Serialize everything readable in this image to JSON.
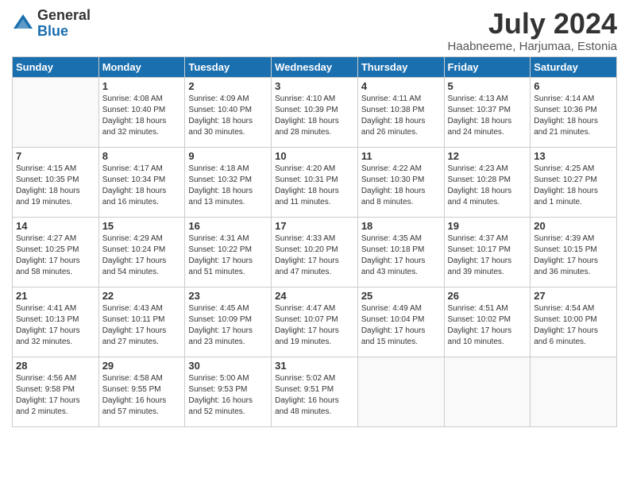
{
  "logo": {
    "general": "General",
    "blue": "Blue"
  },
  "header": {
    "title": "July 2024",
    "subtitle": "Haabneeme, Harjumaa, Estonia"
  },
  "weekdays": [
    "Sunday",
    "Monday",
    "Tuesday",
    "Wednesday",
    "Thursday",
    "Friday",
    "Saturday"
  ],
  "weeks": [
    [
      {
        "day": "",
        "sunrise": "",
        "sunset": "",
        "daylight": ""
      },
      {
        "day": "1",
        "sunrise": "Sunrise: 4:08 AM",
        "sunset": "Sunset: 10:40 PM",
        "daylight": "Daylight: 18 hours and 32 minutes."
      },
      {
        "day": "2",
        "sunrise": "Sunrise: 4:09 AM",
        "sunset": "Sunset: 10:40 PM",
        "daylight": "Daylight: 18 hours and 30 minutes."
      },
      {
        "day": "3",
        "sunrise": "Sunrise: 4:10 AM",
        "sunset": "Sunset: 10:39 PM",
        "daylight": "Daylight: 18 hours and 28 minutes."
      },
      {
        "day": "4",
        "sunrise": "Sunrise: 4:11 AM",
        "sunset": "Sunset: 10:38 PM",
        "daylight": "Daylight: 18 hours and 26 minutes."
      },
      {
        "day": "5",
        "sunrise": "Sunrise: 4:13 AM",
        "sunset": "Sunset: 10:37 PM",
        "daylight": "Daylight: 18 hours and 24 minutes."
      },
      {
        "day": "6",
        "sunrise": "Sunrise: 4:14 AM",
        "sunset": "Sunset: 10:36 PM",
        "daylight": "Daylight: 18 hours and 21 minutes."
      }
    ],
    [
      {
        "day": "7",
        "sunrise": "Sunrise: 4:15 AM",
        "sunset": "Sunset: 10:35 PM",
        "daylight": "Daylight: 18 hours and 19 minutes."
      },
      {
        "day": "8",
        "sunrise": "Sunrise: 4:17 AM",
        "sunset": "Sunset: 10:34 PM",
        "daylight": "Daylight: 18 hours and 16 minutes."
      },
      {
        "day": "9",
        "sunrise": "Sunrise: 4:18 AM",
        "sunset": "Sunset: 10:32 PM",
        "daylight": "Daylight: 18 hours and 13 minutes."
      },
      {
        "day": "10",
        "sunrise": "Sunrise: 4:20 AM",
        "sunset": "Sunset: 10:31 PM",
        "daylight": "Daylight: 18 hours and 11 minutes."
      },
      {
        "day": "11",
        "sunrise": "Sunrise: 4:22 AM",
        "sunset": "Sunset: 10:30 PM",
        "daylight": "Daylight: 18 hours and 8 minutes."
      },
      {
        "day": "12",
        "sunrise": "Sunrise: 4:23 AM",
        "sunset": "Sunset: 10:28 PM",
        "daylight": "Daylight: 18 hours and 4 minutes."
      },
      {
        "day": "13",
        "sunrise": "Sunrise: 4:25 AM",
        "sunset": "Sunset: 10:27 PM",
        "daylight": "Daylight: 18 hours and 1 minute."
      }
    ],
    [
      {
        "day": "14",
        "sunrise": "Sunrise: 4:27 AM",
        "sunset": "Sunset: 10:25 PM",
        "daylight": "Daylight: 17 hours and 58 minutes."
      },
      {
        "day": "15",
        "sunrise": "Sunrise: 4:29 AM",
        "sunset": "Sunset: 10:24 PM",
        "daylight": "Daylight: 17 hours and 54 minutes."
      },
      {
        "day": "16",
        "sunrise": "Sunrise: 4:31 AM",
        "sunset": "Sunset: 10:22 PM",
        "daylight": "Daylight: 17 hours and 51 minutes."
      },
      {
        "day": "17",
        "sunrise": "Sunrise: 4:33 AM",
        "sunset": "Sunset: 10:20 PM",
        "daylight": "Daylight: 17 hours and 47 minutes."
      },
      {
        "day": "18",
        "sunrise": "Sunrise: 4:35 AM",
        "sunset": "Sunset: 10:18 PM",
        "daylight": "Daylight: 17 hours and 43 minutes."
      },
      {
        "day": "19",
        "sunrise": "Sunrise: 4:37 AM",
        "sunset": "Sunset: 10:17 PM",
        "daylight": "Daylight: 17 hours and 39 minutes."
      },
      {
        "day": "20",
        "sunrise": "Sunrise: 4:39 AM",
        "sunset": "Sunset: 10:15 PM",
        "daylight": "Daylight: 17 hours and 36 minutes."
      }
    ],
    [
      {
        "day": "21",
        "sunrise": "Sunrise: 4:41 AM",
        "sunset": "Sunset: 10:13 PM",
        "daylight": "Daylight: 17 hours and 32 minutes."
      },
      {
        "day": "22",
        "sunrise": "Sunrise: 4:43 AM",
        "sunset": "Sunset: 10:11 PM",
        "daylight": "Daylight: 17 hours and 27 minutes."
      },
      {
        "day": "23",
        "sunrise": "Sunrise: 4:45 AM",
        "sunset": "Sunset: 10:09 PM",
        "daylight": "Daylight: 17 hours and 23 minutes."
      },
      {
        "day": "24",
        "sunrise": "Sunrise: 4:47 AM",
        "sunset": "Sunset: 10:07 PM",
        "daylight": "Daylight: 17 hours and 19 minutes."
      },
      {
        "day": "25",
        "sunrise": "Sunrise: 4:49 AM",
        "sunset": "Sunset: 10:04 PM",
        "daylight": "Daylight: 17 hours and 15 minutes."
      },
      {
        "day": "26",
        "sunrise": "Sunrise: 4:51 AM",
        "sunset": "Sunset: 10:02 PM",
        "daylight": "Daylight: 17 hours and 10 minutes."
      },
      {
        "day": "27",
        "sunrise": "Sunrise: 4:54 AM",
        "sunset": "Sunset: 10:00 PM",
        "daylight": "Daylight: 17 hours and 6 minutes."
      }
    ],
    [
      {
        "day": "28",
        "sunrise": "Sunrise: 4:56 AM",
        "sunset": "Sunset: 9:58 PM",
        "daylight": "Daylight: 17 hours and 2 minutes."
      },
      {
        "day": "29",
        "sunrise": "Sunrise: 4:58 AM",
        "sunset": "Sunset: 9:55 PM",
        "daylight": "Daylight: 16 hours and 57 minutes."
      },
      {
        "day": "30",
        "sunrise": "Sunrise: 5:00 AM",
        "sunset": "Sunset: 9:53 PM",
        "daylight": "Daylight: 16 hours and 52 minutes."
      },
      {
        "day": "31",
        "sunrise": "Sunrise: 5:02 AM",
        "sunset": "Sunset: 9:51 PM",
        "daylight": "Daylight: 16 hours and 48 minutes."
      },
      {
        "day": "",
        "sunrise": "",
        "sunset": "",
        "daylight": ""
      },
      {
        "day": "",
        "sunrise": "",
        "sunset": "",
        "daylight": ""
      },
      {
        "day": "",
        "sunrise": "",
        "sunset": "",
        "daylight": ""
      }
    ]
  ]
}
